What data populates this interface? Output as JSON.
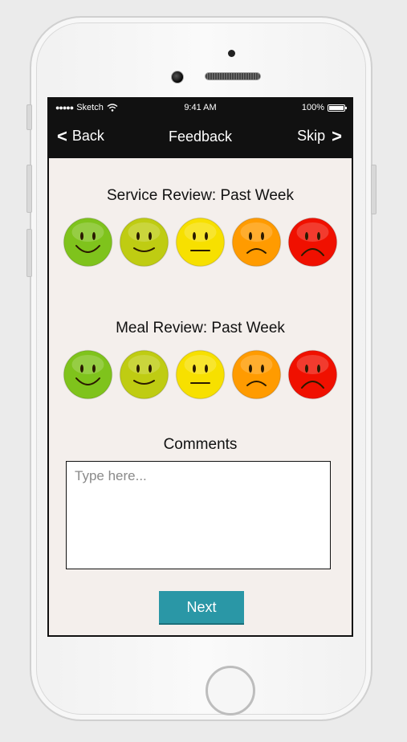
{
  "status_bar": {
    "carrier": "Sketch",
    "time": "9:41 AM",
    "battery": "100%"
  },
  "navbar": {
    "back_label": "Back",
    "title": "Feedback",
    "skip_label": "Skip"
  },
  "service_review": {
    "title": "Service Review: Past Week",
    "options": [
      {
        "name": "very-happy-face-icon",
        "color": "#7fc31c"
      },
      {
        "name": "happy-face-icon",
        "color": "#bfcc12"
      },
      {
        "name": "neutral-face-icon",
        "color": "#f7e000"
      },
      {
        "name": "sad-face-icon",
        "color": "#ff9b00"
      },
      {
        "name": "very-sad-face-icon",
        "color": "#f01000"
      }
    ]
  },
  "meal_review": {
    "title": "Meal Review: Past Week",
    "options": [
      {
        "name": "very-happy-face-icon",
        "color": "#7fc31c"
      },
      {
        "name": "happy-face-icon",
        "color": "#bfcc12"
      },
      {
        "name": "neutral-face-icon",
        "color": "#f7e000"
      },
      {
        "name": "sad-face-icon",
        "color": "#ff9b00"
      },
      {
        "name": "very-sad-face-icon",
        "color": "#f01000"
      }
    ]
  },
  "comments": {
    "title": "Comments",
    "placeholder": "Type here...",
    "value": ""
  },
  "next_button": {
    "label": "Next",
    "color": "#2a97a6"
  }
}
